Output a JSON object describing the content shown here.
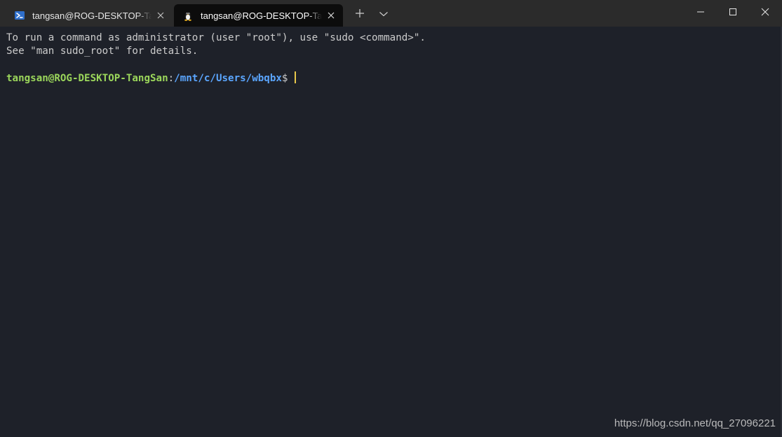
{
  "tabs": [
    {
      "title": "tangsan@ROG-DESKTOP-TangSan: /mnt/c/Users/wbqbx",
      "icon": "powershell-icon",
      "active": false
    },
    {
      "title": "tangsan@ROG-DESKTOP-TangSan: /mnt/c/Users/wbqbx",
      "icon": "linux-penguin-icon",
      "active": true
    }
  ],
  "toolbar": {
    "new_tab_icon": "plus-icon",
    "dropdown_icon": "chevron-down-icon"
  },
  "window_controls": {
    "minimize_icon": "minimize-icon",
    "maximize_icon": "maximize-icon",
    "close_icon": "close-icon"
  },
  "terminal": {
    "lines": [
      "To run a command as administrator (user \"root\"), use \"sudo <command>\".",
      "See \"man sudo_root\" for details."
    ],
    "prompt": {
      "user_host": "tangsan@ROG-DESKTOP-TangSan",
      "colon": ":",
      "path": "/mnt/c/Users/wbqbx",
      "symbol": "$ "
    }
  },
  "watermark": "https://blog.csdn.net/qq_27096221",
  "colors": {
    "background": "#1e2129",
    "titlebar": "#2b2b2b",
    "active_tab": "#0c0c0c",
    "prompt_user": "#9bd65b",
    "prompt_path": "#5ba6ff",
    "cursor": "#e8c84a"
  }
}
